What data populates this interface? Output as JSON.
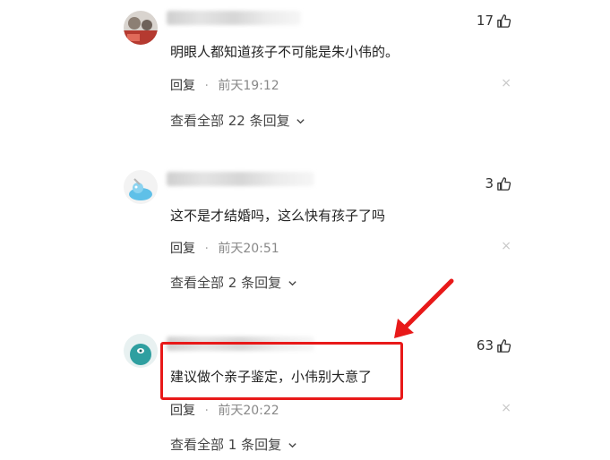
{
  "comments": [
    {
      "likes": "17",
      "text": "明眼人都知道孩子不可能是朱小伟的。",
      "reply_label": "回复",
      "time": "前天19:12",
      "view_all": "查看全部 22 条回复",
      "avatar_color": "#c8473e"
    },
    {
      "likes": "3",
      "text": "这不是才结婚吗，这么快有孩子了吗",
      "reply_label": "回复",
      "time": "前天20:51",
      "view_all": "查看全部 2 条回复",
      "avatar_color": "#5fc0e8"
    },
    {
      "likes": "63",
      "text": "建议做个亲子鉴定，小伟别大意了",
      "reply_label": "回复",
      "time": "前天20:22",
      "view_all": "查看全部 1 条回复",
      "avatar_color": "#2f9fa0"
    }
  ],
  "meta_separator": "·",
  "close_glyph": "×",
  "highlight_color": "#e81919"
}
